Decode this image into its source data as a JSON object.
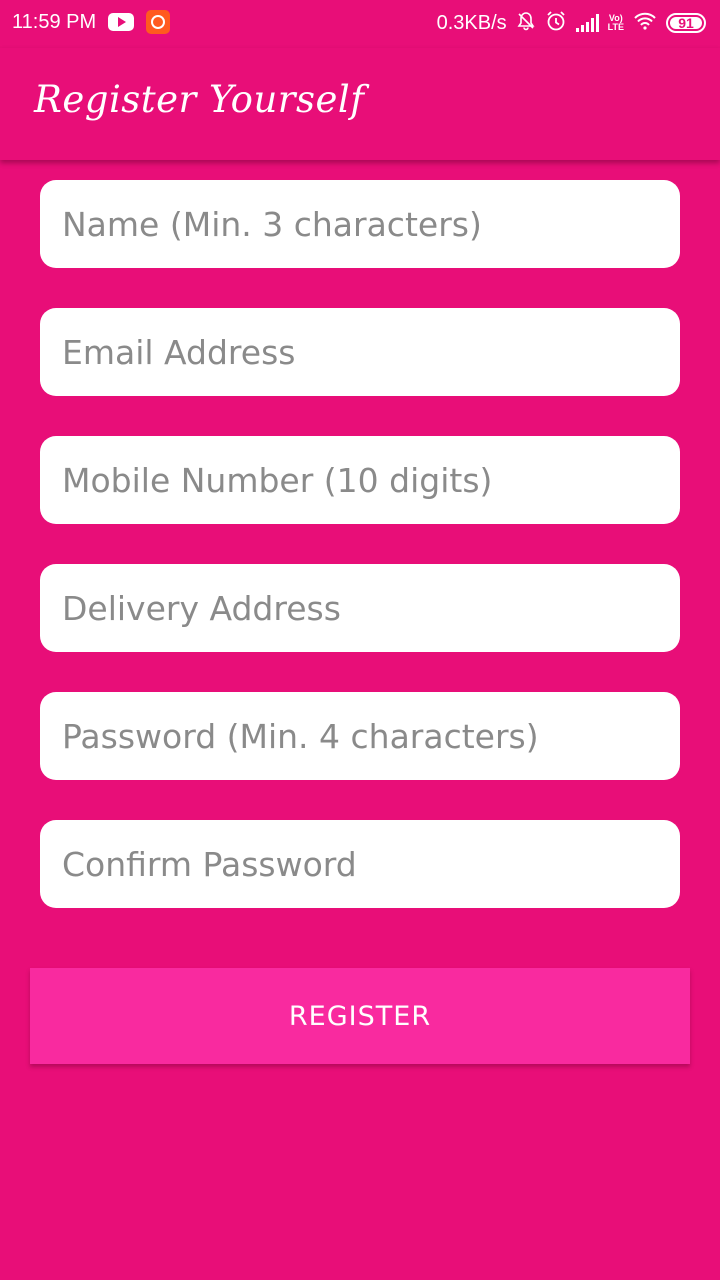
{
  "status_bar": {
    "time": "11:59 PM",
    "network_speed": "0.3KB/s",
    "lte_label_top": "Vo)",
    "lte_label_bottom": "LTE",
    "battery_level": "91",
    "icons": [
      "youtube-icon",
      "app-notification-icon",
      "mute-bell-icon",
      "alarm-icon",
      "signal-icon",
      "lte-icon",
      "wifi-icon",
      "battery-icon"
    ]
  },
  "app_bar": {
    "title": "Register Yourself"
  },
  "form": {
    "name": {
      "placeholder": "Name (Min. 3 characters)",
      "value": ""
    },
    "email": {
      "placeholder": "Email Address",
      "value": ""
    },
    "mobile": {
      "placeholder": "Mobile Number (10 digits)",
      "value": ""
    },
    "address": {
      "placeholder": "Delivery Address",
      "value": ""
    },
    "password": {
      "placeholder": "Password (Min. 4 characters)",
      "value": ""
    },
    "confirm_password": {
      "placeholder": "Confirm Password",
      "value": ""
    },
    "register_label": "REGISTER"
  },
  "colors": {
    "background": "#e80e78",
    "button": "#f92a9f",
    "field": "#ffffff",
    "placeholder": "#8a8a8a"
  }
}
